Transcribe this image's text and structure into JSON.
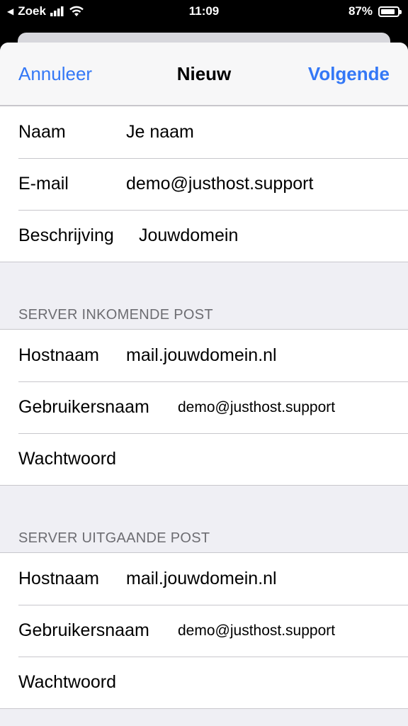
{
  "status": {
    "back_app": "Zoek",
    "time": "11:09",
    "battery": "87%",
    "battery_level": 0.87
  },
  "nav": {
    "cancel": "Annuleer",
    "title": "Nieuw",
    "next": "Volgende"
  },
  "account": {
    "rows": [
      {
        "label": "Naam",
        "value": "Je naam"
      },
      {
        "label": "E-mail",
        "value": "demo@justhost.support"
      },
      {
        "label": "Beschrijving",
        "value": "Jouwdomein"
      }
    ]
  },
  "incoming": {
    "header": "SERVER INKOMENDE POST",
    "rows": [
      {
        "label": "Hostnaam",
        "value": "mail.jouwdomein.nl"
      },
      {
        "label": "Gebruikersnaam",
        "value": "demo@justhost.support"
      },
      {
        "label": "Wachtwoord",
        "value": ""
      }
    ]
  },
  "outgoing": {
    "header": "SERVER UITGAANDE POST",
    "rows": [
      {
        "label": "Hostnaam",
        "value": "mail.jouwdomein.nl"
      },
      {
        "label": "Gebruikersnaam",
        "value": "demo@justhost.support"
      },
      {
        "label": "Wachtwoord",
        "value": ""
      }
    ]
  },
  "colors": {
    "accent": "#3478f6",
    "group_bg": "#efeff4",
    "section_text": "#6d6d72"
  }
}
